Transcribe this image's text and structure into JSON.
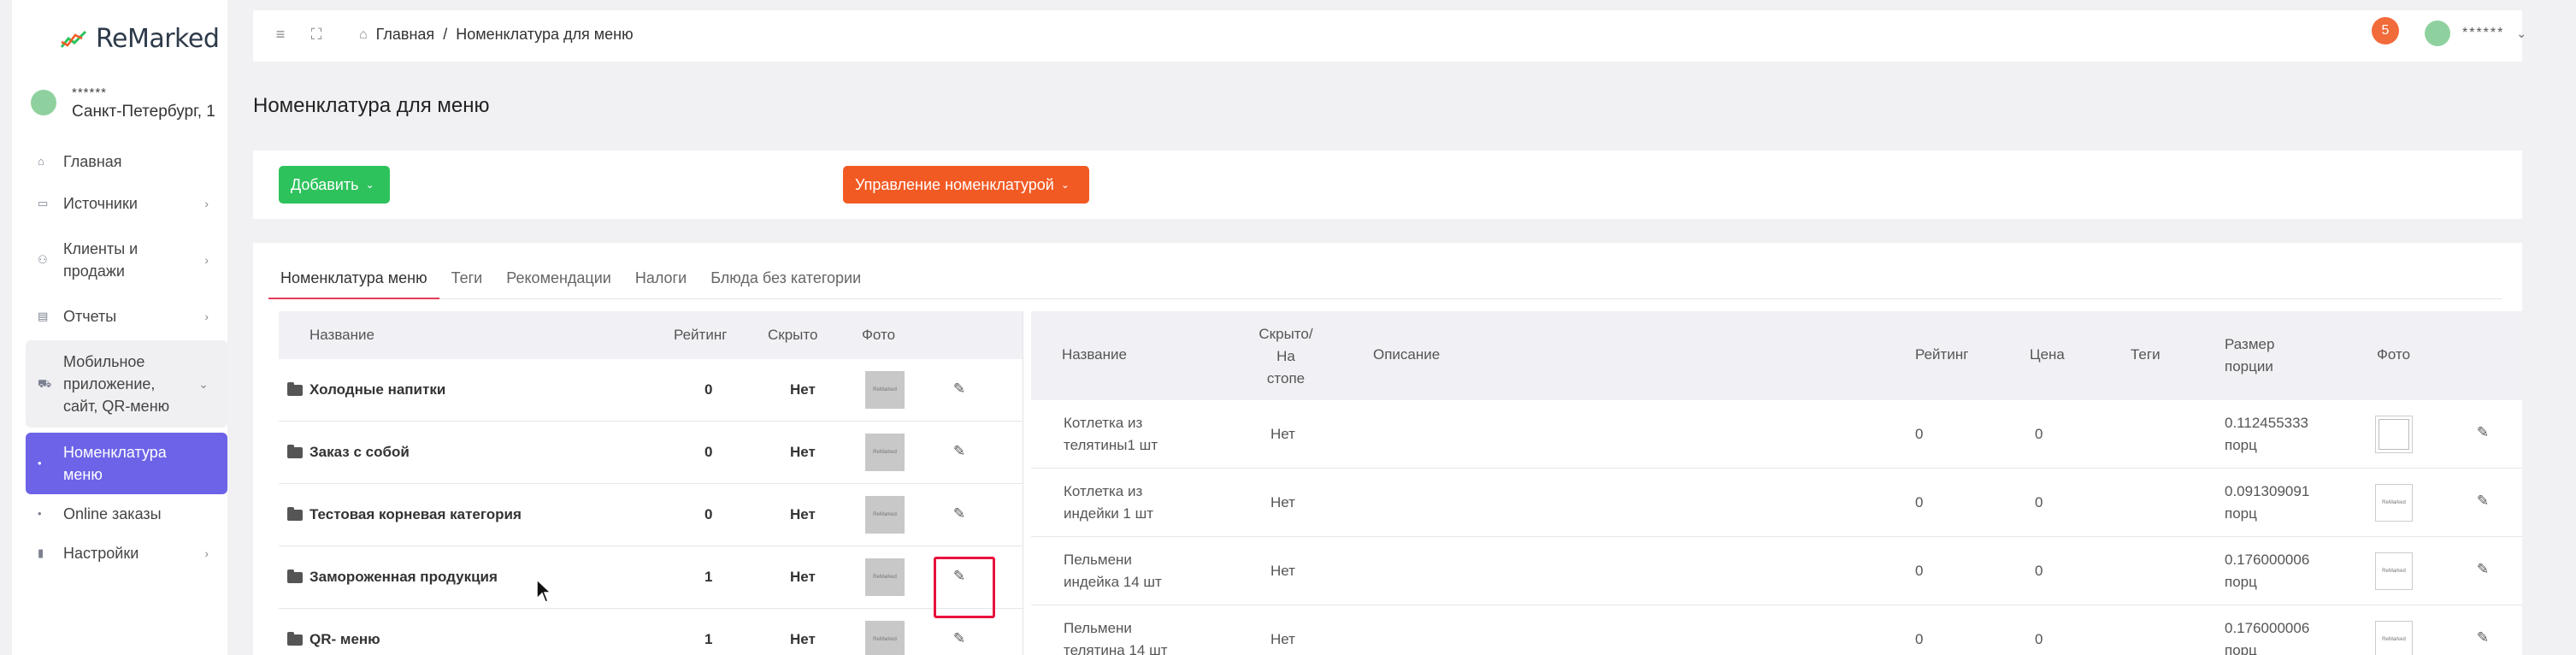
{
  "app": {
    "logo_text": "ReMarked"
  },
  "sidebar": {
    "user_name": "******",
    "user_place": "Санкт-Петербург, 1",
    "items": [
      {
        "label": "Главная",
        "icon": "home-icon"
      },
      {
        "label": "Источники",
        "icon": "monitor-icon"
      },
      {
        "label": "Клиенты и продажи",
        "icon": "users-icon"
      },
      {
        "label": "Отчеты",
        "icon": "chart-icon"
      },
      {
        "label": "Мобильное приложение, сайт, QR-меню",
        "icon": "cart-icon"
      },
      {
        "label": "Номенклатура меню",
        "icon": "dot-icon"
      },
      {
        "label": "Online заказы",
        "icon": "dot-icon"
      },
      {
        "label": "Настройки",
        "icon": "bookmark-icon"
      }
    ]
  },
  "topbar": {
    "breadcrumb_home": "Главная",
    "breadcrumb_sep": "/",
    "breadcrumb_current": "Номенклатура для меню",
    "notif_count": "5",
    "user_name": "******"
  },
  "page": {
    "title": "Номенклатура для меню"
  },
  "actions": {
    "add_label": "Добавить",
    "manage_label": "Управление номенклатурой"
  },
  "tabs": [
    "Номенклатура меню",
    "Теги",
    "Рекомендации",
    "Налоги",
    "Блюда без категории"
  ],
  "categories": {
    "headers": {
      "name": "Название",
      "rating": "Рейтинг",
      "hidden": "Скрыто",
      "photo": "Фото"
    },
    "rows": [
      {
        "name": "Холодные напитки",
        "rating": "0",
        "hidden": "Нет"
      },
      {
        "name": "Заказ с собой",
        "rating": "0",
        "hidden": "Нет"
      },
      {
        "name": "Тестовая корневая категория",
        "rating": "0",
        "hidden": "Нет"
      },
      {
        "name": "Замороженная продукция",
        "rating": "1",
        "hidden": "Нет"
      },
      {
        "name": "QR- меню",
        "rating": "1",
        "hidden": "Нет"
      }
    ]
  },
  "items": {
    "headers": {
      "name": "Название",
      "hidden_l1": "Скрыто/",
      "hidden_l2": "На",
      "hidden_l3": "стопе",
      "description": "Описание",
      "rating": "Рейтинг",
      "price": "Цена",
      "tags": "Теги",
      "portion_l1": "Размер",
      "portion_l2": "порции",
      "photo": "Фото"
    },
    "rows": [
      {
        "name_l1": "Котлетка из",
        "name_l2": "телятины1 шт",
        "hidden": "Нет",
        "rating": "0",
        "price": "0",
        "portion_l1": "0.112455333",
        "portion_l2": "порц"
      },
      {
        "name_l1": "Котлетка из",
        "name_l2": "индейки 1 шт",
        "hidden": "Нет",
        "rating": "0",
        "price": "0",
        "portion_l1": "0.091309091",
        "portion_l2": "порц"
      },
      {
        "name_l1": "Пельмени",
        "name_l2": "индейка 14 шт",
        "hidden": "Нет",
        "rating": "0",
        "price": "0",
        "portion_l1": "0.176000006",
        "portion_l2": "порц"
      },
      {
        "name_l1": "Пельмени",
        "name_l2": "телятина 14 шт",
        "hidden": "Нет",
        "rating": "0",
        "price": "0",
        "portion_l1": "0.176000006",
        "portion_l2": "порц"
      }
    ]
  },
  "thumb_text": "ReMarked",
  "colors": {
    "accent": "#6c63e8",
    "add": "#2ec25c",
    "manage": "#f25a24",
    "highlight": "#e8123c"
  }
}
